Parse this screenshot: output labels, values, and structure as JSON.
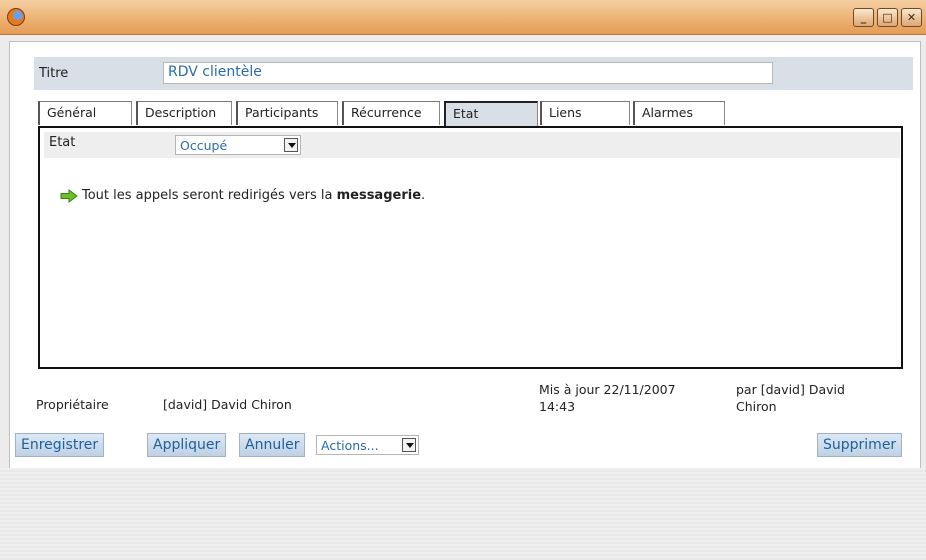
{
  "window": {
    "minimize_glyph": "_",
    "maximize_glyph": "□",
    "close_glyph": "✕"
  },
  "form": {
    "title_label": "Titre",
    "title_value": "RDV clientèle"
  },
  "tabs": [
    {
      "label": "Général"
    },
    {
      "label": "Description"
    },
    {
      "label": "Participants"
    },
    {
      "label": "Récurrence"
    },
    {
      "label": "Etat",
      "active": true
    },
    {
      "label": "Liens"
    },
    {
      "label": "Alarmes"
    }
  ],
  "etat": {
    "label": "Etat",
    "selected": "Occupé",
    "info_prefix": "Tout les appels seront redirigés vers la ",
    "info_bold": "messagerie",
    "info_suffix": "."
  },
  "footer": {
    "owner_label": "Propriétaire",
    "owner_value": "[david] David Chiron",
    "updated_line1": "Mis à jour 22/11/2007",
    "updated_line2": "14:43",
    "by_line1": "par [david] David",
    "by_line2": "Chiron"
  },
  "buttons": {
    "save": "Enregistrer",
    "apply": "Appliquer",
    "cancel": "Annuler",
    "actions": "Actions...",
    "delete": "Supprimer"
  },
  "icons": {
    "app": "firefox-icon",
    "info": "green-arrow-icon"
  }
}
